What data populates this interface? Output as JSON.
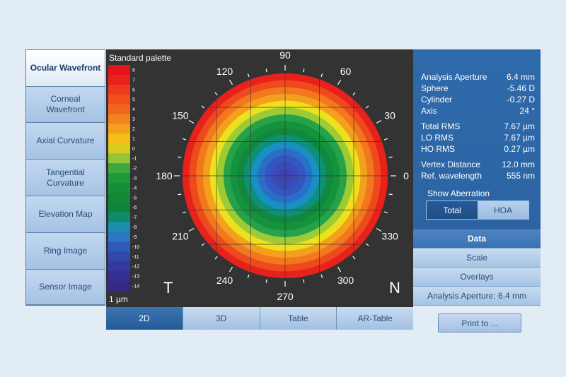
{
  "nav": [
    {
      "label": "Ocular Wavefront",
      "active": true
    },
    {
      "label": "Corneal\nWavefront",
      "active": false
    },
    {
      "label": "Axial Curvature",
      "active": false
    },
    {
      "label": "Tangential\nCurvature",
      "active": false
    },
    {
      "label": "Elevation Map",
      "active": false
    },
    {
      "label": "Ring Image",
      "active": false
    },
    {
      "label": "Sensor Image",
      "active": false
    }
  ],
  "map": {
    "palette_title": "Standard palette",
    "unit": "1 µm",
    "scale_labels": [
      "8",
      "7",
      "6",
      "5",
      "4",
      "3",
      "2",
      "1",
      "0",
      "-1",
      "-2",
      "-3",
      "-4",
      "-5",
      "-6",
      "-7",
      "-8",
      "-9",
      "-10",
      "-11",
      "-12",
      "-13",
      "-14"
    ],
    "scale_colors": [
      "#e4141a",
      "#e8231b",
      "#ec3a1c",
      "#ef4e1d",
      "#f0661d",
      "#f2821e",
      "#f3a01d",
      "#f4bd17",
      "#d9cc1e",
      "#93c43a",
      "#3fa73f",
      "#1c9a3c",
      "#178f3a",
      "#148836",
      "#10833c",
      "#0e8a6c",
      "#1a8fb0",
      "#2a76c4",
      "#2e5aba",
      "#3148ac",
      "#33399f",
      "#352f91",
      "#342a84"
    ],
    "angles": [
      "90",
      "60",
      "30",
      "0",
      "330",
      "300",
      "270",
      "240",
      "210",
      "180",
      "150",
      "120"
    ],
    "side_left": "T",
    "side_right": "N",
    "rings": [
      {
        "color": "#e8221b"
      },
      {
        "color": "#ee4a1d"
      },
      {
        "color": "#f2781e"
      },
      {
        "color": "#f4a01d"
      },
      {
        "color": "#ece11c"
      },
      {
        "color": "#9ccb36"
      },
      {
        "color": "#27a14a"
      },
      {
        "color": "#14923c"
      },
      {
        "color": "#10893f"
      },
      {
        "color": "#0e8f78"
      },
      {
        "color": "#1890c4"
      },
      {
        "color": "#2b6ec8"
      },
      {
        "color": "#3456c0"
      },
      {
        "color": "#3b4ab6"
      },
      {
        "color": "#3d44b0"
      }
    ]
  },
  "tabs": [
    {
      "label": "2D",
      "active": true
    },
    {
      "label": "3D",
      "active": false
    },
    {
      "label": "Table",
      "active": false
    },
    {
      "label": "AR-Table",
      "active": false
    }
  ],
  "info": {
    "rows": [
      {
        "k": "Analysis Aperture",
        "v": "6.4 mm"
      },
      {
        "k": "Sphere",
        "v": "-5.46 D"
      },
      {
        "k": "Cylinder",
        "v": "-0.27 D"
      },
      {
        "k": "Axis",
        "v": "24 °"
      },
      {
        "k": "Total RMS",
        "v": "7.67 µm"
      },
      {
        "k": "LO RMS",
        "v": "7.67 µm"
      },
      {
        "k": "HO RMS",
        "v": "0.27 µm"
      },
      {
        "k": "Vertex Distance",
        "v": "12.0 mm"
      },
      {
        "k": "Ref. wavelength",
        "v": "555 nm"
      }
    ],
    "show_aberration": "Show Aberration",
    "total_label": "Total",
    "hoa_label": "HOA"
  },
  "buttons": {
    "data": "Data",
    "scale": "Scale",
    "overlays": "Overlays",
    "aperture": "Analysis Aperture: 6.4 mm",
    "print": "Print to ..."
  }
}
